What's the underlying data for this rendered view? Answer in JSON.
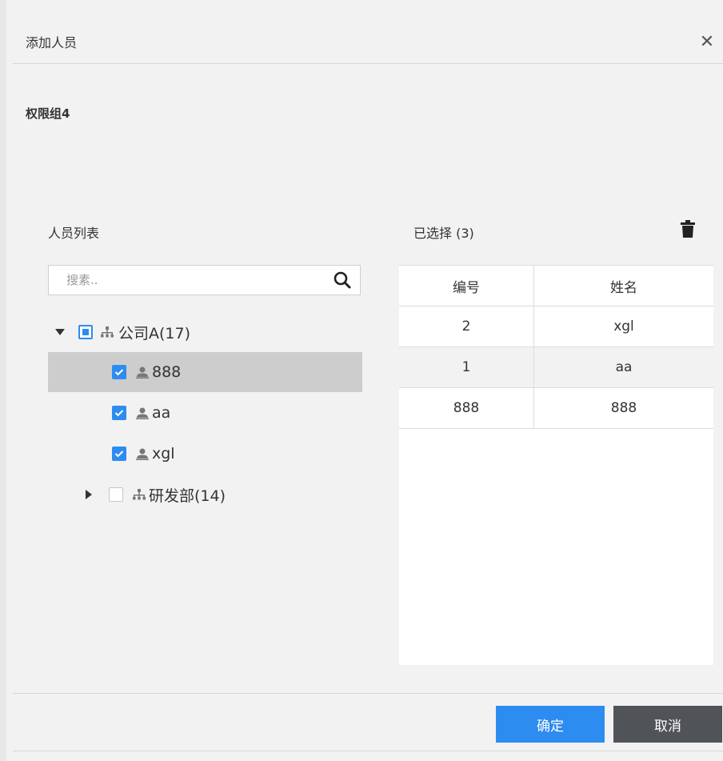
{
  "dialog": {
    "title": "添加人员",
    "group_name": "权限组4"
  },
  "person_list": {
    "label": "人员列表",
    "search_placeholder": "搜素..",
    "tree": [
      {
        "label": "公司A(17)",
        "type": "org",
        "expanded": true,
        "check": "partial"
      },
      {
        "label": "888",
        "type": "person",
        "check": "checked",
        "selected": true
      },
      {
        "label": "aa",
        "type": "person",
        "check": "checked"
      },
      {
        "label": "xgl",
        "type": "person",
        "check": "checked"
      },
      {
        "label": "研发部(14)",
        "type": "org",
        "expanded": false,
        "check": "unchecked"
      }
    ]
  },
  "selected": {
    "label": "已选择 (3)",
    "columns": [
      "编号",
      "姓名"
    ],
    "rows": [
      [
        "2",
        "xgl"
      ],
      [
        "1",
        "aa"
      ],
      [
        "888",
        "888"
      ]
    ]
  },
  "buttons": {
    "ok": "确定",
    "cancel": "取消"
  },
  "colors": {
    "accent": "#2d8cf0",
    "cancel_button": "#505459",
    "selected_row": "#cdcdcd"
  }
}
